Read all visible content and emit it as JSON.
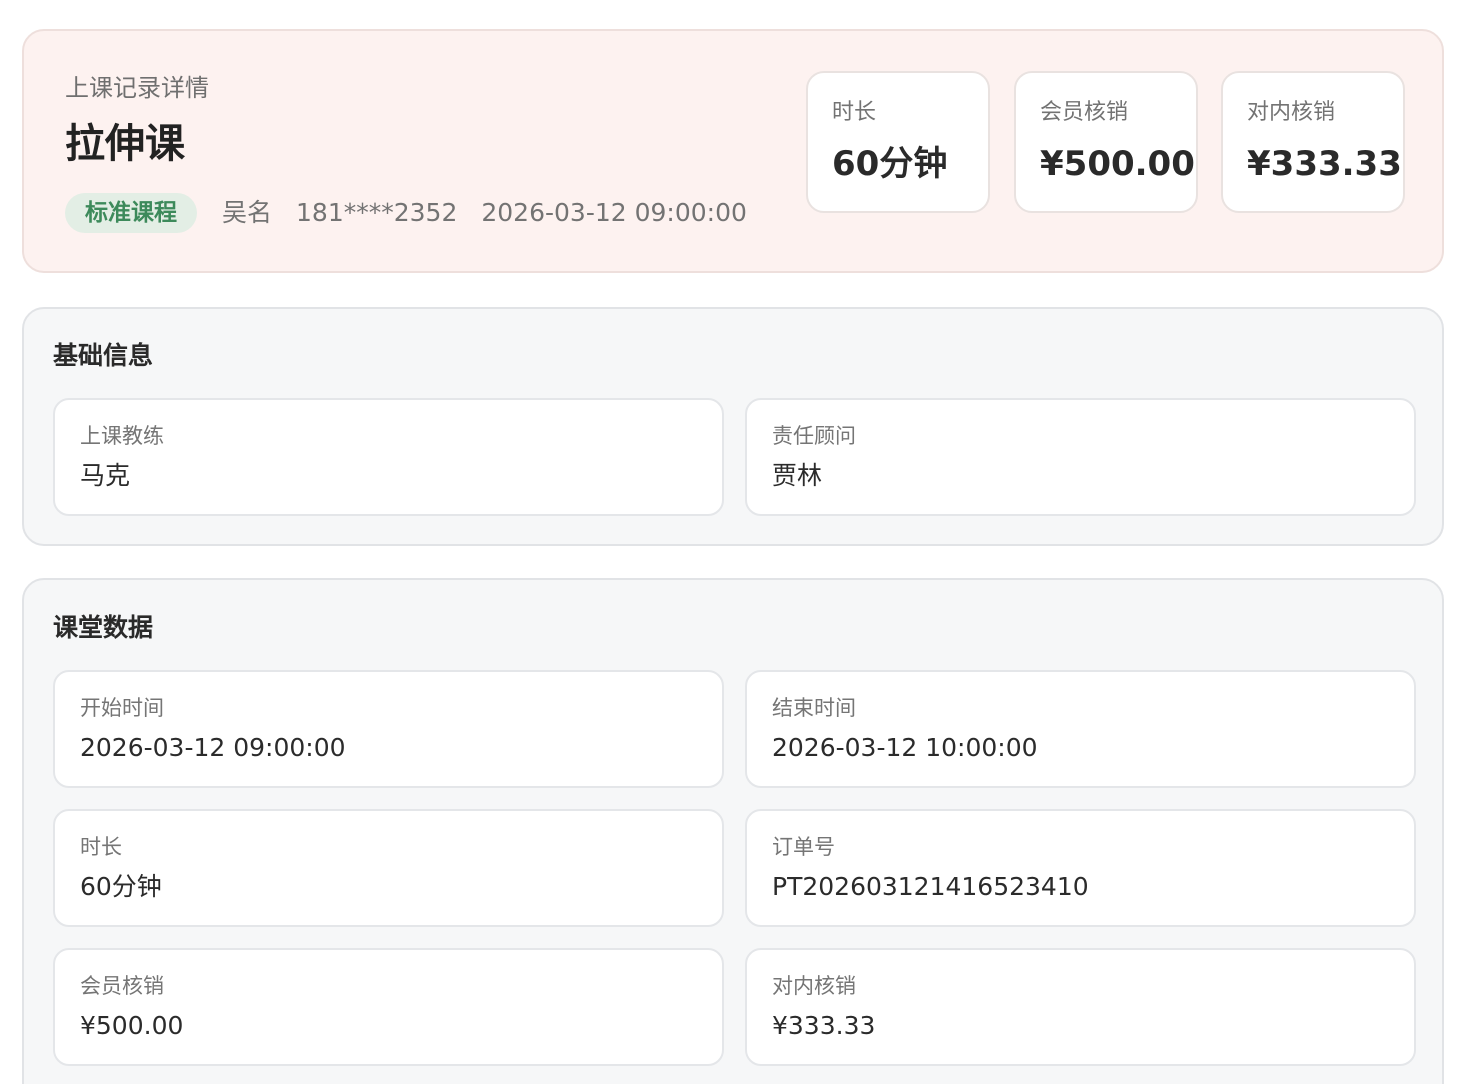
{
  "header": {
    "eyebrow": "上课记录详情",
    "title": "拉伸课",
    "badge": "标准课程",
    "member_name": "吴名",
    "member_phone": "181****2352",
    "class_datetime": "2026-03-12 09:00:00",
    "stats": [
      {
        "label": "时长",
        "value": "60分钟"
      },
      {
        "label": "会员核销",
        "value": "¥500.00"
      },
      {
        "label": "对内核销",
        "value": "¥333.33"
      }
    ]
  },
  "basic_info": {
    "title": "基础信息",
    "fields": [
      {
        "label": "上课教练",
        "value": "马克"
      },
      {
        "label": "责任顾问",
        "value": "贾林"
      }
    ]
  },
  "class_data": {
    "title": "课堂数据",
    "fields": [
      {
        "label": "开始时间",
        "value": "2026-03-12 09:00:00"
      },
      {
        "label": "结束时间",
        "value": "2026-03-12 10:00:00"
      },
      {
        "label": "时长",
        "value": "60分钟"
      },
      {
        "label": "订单号",
        "value": "PT202603121416523410"
      },
      {
        "label": "会员核销",
        "value": "¥500.00"
      },
      {
        "label": "对内核销",
        "value": "¥333.33"
      }
    ]
  },
  "colors": {
    "header_bg": "#fdf2f0",
    "badge_bg": "#e3eee5",
    "badge_text": "#3d8a5b",
    "section_bg": "#f6f7f8"
  }
}
